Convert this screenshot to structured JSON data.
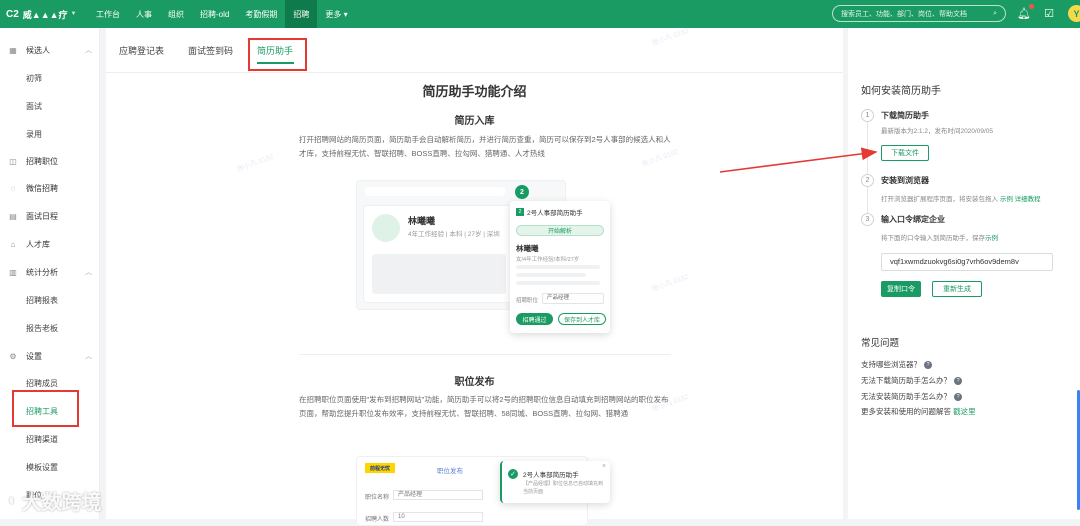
{
  "topbar": {
    "org_badge": "C2",
    "org_name": "威▲▲▲疗",
    "nav": [
      "工作台",
      "人事",
      "组织",
      "招聘-old",
      "考勤假期",
      "招聘",
      "更多 ▾"
    ],
    "search_placeholder": "搜索员工、功能、部门、岗位、帮助文档",
    "avatar": "Y",
    "accent": "#1a9b63"
  },
  "sidebar": {
    "groups": [
      {
        "label": "候选人",
        "icon": "grid-icon",
        "children": [
          "初筛",
          "面试",
          "录用"
        ]
      },
      {
        "label": "招聘职位",
        "icon": "briefcase-icon",
        "children": []
      },
      {
        "label": "微信招聘",
        "icon": "chat-icon",
        "children": []
      },
      {
        "label": "面试日程",
        "icon": "calendar-icon",
        "children": []
      },
      {
        "label": "人才库",
        "icon": "people-icon",
        "children": []
      },
      {
        "label": "统计分析",
        "icon": "chart-icon",
        "children": [
          "招聘报表",
          "报告老板"
        ]
      },
      {
        "label": "设置",
        "icon": "gear-icon",
        "children": [
          "招聘成员",
          "招聘工具",
          "招聘渠道",
          "模板设置"
        ]
      }
    ],
    "footer_cut": "职位"
  },
  "tabs": [
    "应聘登记表",
    "面试签到码",
    "简历助手"
  ],
  "main": {
    "title": "简历助手功能介绍",
    "s1_title": "简历入库",
    "s1_desc": "打开招聘网站的简历页面，简历助手会自动解析简历，并进行简历查重，简历可以保存到2号人事部的候选人和人才库，支持前程无忧、智联招聘、BOSS直聘、拉勾网、猎聘通、人才热线",
    "card_name": "林曦曦",
    "card_info": "4年工作经验",
    "card_edu": "本科",
    "card_age": "27岁",
    "card_city": "深圳",
    "popup_title": "2号人事部简历助手",
    "popup_parse": "开始解析",
    "popup_name": "林曦曦",
    "popup_meta": "女/4年工作经验/本科/27岁",
    "popup_pos_label": "招聘职位",
    "popup_pos_val": "产品经理",
    "popup_btn1": "招聘通过",
    "popup_btn2": "保存到人才库",
    "s2_title": "职位发布",
    "s2_desc": "在招聘职位页面使用\"发布到招聘网站\"功能，简历助手可以将2号的招聘职位信息自动填充到招聘网站的职位发布页面，帮助您提升职位发布效率，支持前程无忧、智联招聘、58同城、BOSS直聘、拉勾网、猎聘通",
    "c2_logo": "前程无忧",
    "c2_tab": "职位发布",
    "c2_row1_label": "职位名称",
    "c2_row1_val": "产品经理",
    "c2_row2_label": "招聘人数",
    "c2_row2_val": "10",
    "toast_title": "2号人事部简历助手",
    "toast_desc": "【产品经理】职位信息已自动填充到当前页面",
    "watermark": "张小凡 0182"
  },
  "right": {
    "title": "如何安装简历助手",
    "step1_title": "下载简历助手",
    "step1_desc": "最新版本为2.1.2，发布时间2020/09/05",
    "step1_btn": "下载文件",
    "step2_title": "安装到浏览器",
    "step2_desc": "打开浏览器扩展程序页面，将安装包拖入",
    "step2_link1": "示例",
    "step2_link2": "详细教程",
    "step3_title": "输入口令绑定企业",
    "step3_desc": "将下面的口令输入到简历助手，保存",
    "step3_link": "示例",
    "token": "vqf1xwmdzuokvg6si0g7vrh6ov9dem8v",
    "copy_btn": "复制口令",
    "regen_btn": "重新生成",
    "faq_title": "常见问题",
    "faq": [
      "支持哪些浏览器？",
      "无法下载简历助手怎么办？",
      "无法安装简历助手怎么办？"
    ],
    "faq_more": "更多安装和使用的问题解答",
    "faq_more_link": "戳这里"
  },
  "overlay": {
    "brand": "大数跨境"
  }
}
